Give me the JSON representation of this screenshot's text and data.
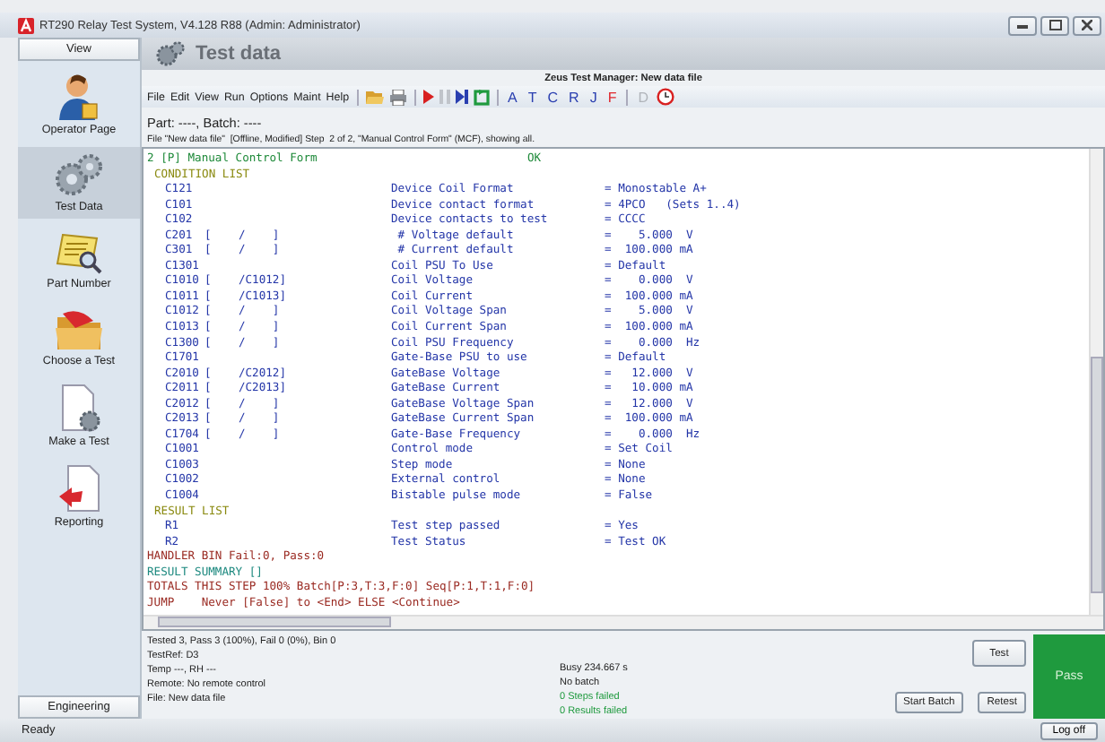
{
  "window": {
    "title": "RT290 Relay Test System, V4.128 R88 (Admin: Administrator)"
  },
  "sidebar": {
    "header": "View",
    "items": [
      {
        "label": "Operator Page",
        "selected": false
      },
      {
        "label": "Test Data",
        "selected": true
      },
      {
        "label": "Part Number",
        "selected": false
      },
      {
        "label": "Choose a Test",
        "selected": false
      },
      {
        "label": "Make a Test",
        "selected": false
      },
      {
        "label": "Reporting",
        "selected": false
      }
    ],
    "footer_button": "Engineering"
  },
  "header": {
    "title": "Test data",
    "subtitle": "Zeus Test Manager: New data file"
  },
  "menu": [
    "File",
    "Edit",
    "View",
    "Run",
    "Options",
    "Maint",
    "Help"
  ],
  "toolbar_letters": [
    {
      "label": "A",
      "color": "#2a3fb0",
      "disabled": false
    },
    {
      "label": "T",
      "color": "#2a3fb0",
      "disabled": false
    },
    {
      "label": "C",
      "color": "#2a3fb0",
      "disabled": false
    },
    {
      "label": "R",
      "color": "#2a3fb0",
      "disabled": false
    },
    {
      "label": "J",
      "color": "#2a3fb0",
      "disabled": false
    },
    {
      "label": "F",
      "color": "#e0282e",
      "disabled": false
    },
    {
      "label": "D",
      "disabled": true
    }
  ],
  "part_line": "Part: ----, Batch: ----",
  "file_line": "File \"New data file\"  [Offline, Modified] Step  2 of 2, \"Manual Control Form\" (MCF), showing all.",
  "listing": [
    {
      "kind": "title",
      "text": "2 [P] Manual Control Form",
      "status": "OK"
    },
    {
      "kind": "section",
      "text": "CONDITION LIST"
    },
    {
      "kind": "item",
      "code": "C121",
      "label": "Device Coil Format",
      "value": "= Monostable A+"
    },
    {
      "kind": "item",
      "code": "C101",
      "label": "Device contact format",
      "value": "= 4PCO   (Sets 1..4)"
    },
    {
      "kind": "item",
      "code": "C102",
      "label": "Device contacts to test",
      "value": "= CCCC"
    },
    {
      "kind": "item",
      "code": "C201",
      "range": "[    /    ]",
      "label": " # Voltage default",
      "value": "=    5.000  V"
    },
    {
      "kind": "item",
      "code": "C301",
      "range": "[    /    ]",
      "label": " # Current default",
      "value": "=  100.000 mA"
    },
    {
      "kind": "item",
      "code": "C1301",
      "label": "Coil PSU To Use",
      "value": "= Default"
    },
    {
      "kind": "item",
      "code": "C1010",
      "range": "[    /C1012]",
      "label": "Coil Voltage",
      "value": "=    0.000  V"
    },
    {
      "kind": "item",
      "code": "C1011",
      "range": "[    /C1013]",
      "label": "Coil Current",
      "value": "=  100.000 mA"
    },
    {
      "kind": "item",
      "code": "C1012",
      "range": "[    /    ]",
      "label": "Coil Voltage Span",
      "value": "=    5.000  V"
    },
    {
      "kind": "item",
      "code": "C1013",
      "range": "[    /    ]",
      "label": "Coil Current Span",
      "value": "=  100.000 mA"
    },
    {
      "kind": "item",
      "code": "C1300",
      "range": "[    /    ]",
      "label": "Coil PSU Frequency",
      "value": "=    0.000  Hz"
    },
    {
      "kind": "item",
      "code": "C1701",
      "label": "Gate-Base PSU to use",
      "value": "= Default"
    },
    {
      "kind": "item",
      "code": "C2010",
      "range": "[    /C2012]",
      "label": "GateBase Voltage",
      "value": "=   12.000  V"
    },
    {
      "kind": "item",
      "code": "C2011",
      "range": "[    /C2013]",
      "label": "GateBase Current",
      "value": "=   10.000 mA"
    },
    {
      "kind": "item",
      "code": "C2012",
      "range": "[    /    ]",
      "label": "GateBase Voltage Span",
      "value": "=   12.000  V"
    },
    {
      "kind": "item",
      "code": "C2013",
      "range": "[    /    ]",
      "label": "GateBase Current Span",
      "value": "=  100.000 mA"
    },
    {
      "kind": "item",
      "code": "C1704",
      "range": "[    /    ]",
      "label": "Gate-Base Frequency",
      "value": "=    0.000  Hz"
    },
    {
      "kind": "item",
      "code": "C1001",
      "label": "Control mode",
      "value": "= Set Coil"
    },
    {
      "kind": "item",
      "code": "C1003",
      "label": "Step mode",
      "value": "= None"
    },
    {
      "kind": "item",
      "code": "C1002",
      "label": "External control",
      "value": "= None"
    },
    {
      "kind": "item",
      "code": "C1004",
      "label": "Bistable pulse mode",
      "value": "= False"
    },
    {
      "kind": "section",
      "text": "RESULT LIST"
    },
    {
      "kind": "item",
      "code": "R1",
      "label": "Test step passed",
      "value": "= Yes"
    },
    {
      "kind": "item",
      "code": "R2",
      "label": "Test Status",
      "value": "= Test OK"
    },
    {
      "kind": "note",
      "text": "HANDLER BIN Fail:0, Pass:0"
    },
    {
      "kind": "summary",
      "text": "RESULT SUMMARY []"
    },
    {
      "kind": "note",
      "text": "TOTALS THIS STEP 100% Batch[P:3,T:3,F:0] Seq[P:1,T:1,F:0]"
    },
    {
      "kind": "note",
      "text": "JUMP    Never [False] to <End> ELSE <Continue>"
    }
  ],
  "status_left": [
    "Tested 3, Pass 3 (100%), Fail 0 (0%), Bin 0",
    "TestRef: D3",
    "Temp ---, RH ---",
    "Remote: No remote control",
    "File: New data file"
  ],
  "status_middle": [
    {
      "text": "Busy 234.667 s",
      "kind": "plain"
    },
    {
      "text": "No batch",
      "kind": "plain"
    },
    {
      "text": "0 Steps failed",
      "kind": "good"
    },
    {
      "text": "0 Results failed",
      "kind": "good"
    }
  ],
  "buttons": {
    "test": "Test",
    "start_batch": "Start Batch",
    "retest": "Retest"
  },
  "result": {
    "text": "Pass",
    "kind": "pass"
  },
  "status_bar": {
    "text": "Ready",
    "button": "Log off"
  }
}
